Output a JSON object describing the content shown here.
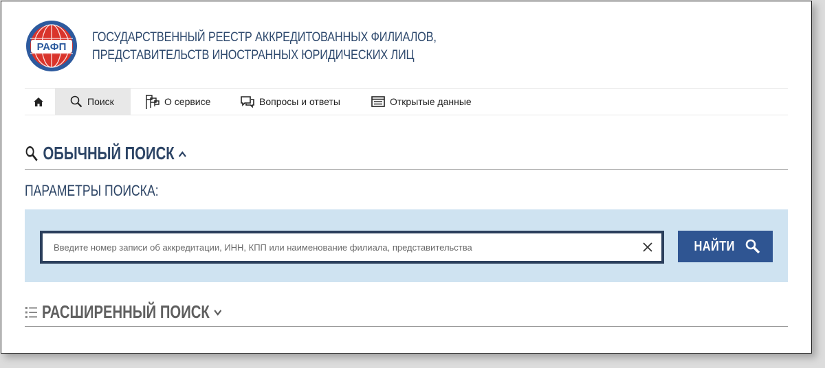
{
  "header": {
    "logo_text": "РАФП",
    "title_line1": "ГОСУДАРСТВЕННЫЙ РЕЕСТР АККРЕДИТОВАННЫХ ФИЛИАЛОВ,",
    "title_line2": "ПРЕДСТАВИТЕЛЬСТВ ИНОСТРАННЫХ ЮРИДИЧЕСКИХ ЛИЦ"
  },
  "nav": {
    "items": [
      {
        "label": "Поиск",
        "icon": "search-icon",
        "active": true
      },
      {
        "label": "О сервисе",
        "icon": "flags-icon"
      },
      {
        "label": "Вопросы и ответы",
        "icon": "chat-icon"
      },
      {
        "label": "Открытые данные",
        "icon": "list-icon"
      }
    ],
    "home_icon": "home-icon"
  },
  "normal_search": {
    "title": "ОБЫЧНЫЙ ПОИСК",
    "params_label": "ПАРАМЕТРЫ ПОИСКА:",
    "input_value": "",
    "input_placeholder": "Введите номер записи об аккредитации, ИНН, КПП или наименование филиала, представительства",
    "button_label": "НАЙТИ"
  },
  "advanced_search": {
    "title": "РАСШИРЕННЫЙ ПОИСК"
  },
  "colors": {
    "brand_dark": "#2c4465",
    "button": "#2f5592",
    "panel": "#cfe3f1",
    "logo_red": "#d9342b",
    "logo_blue": "#2d5a9e"
  }
}
